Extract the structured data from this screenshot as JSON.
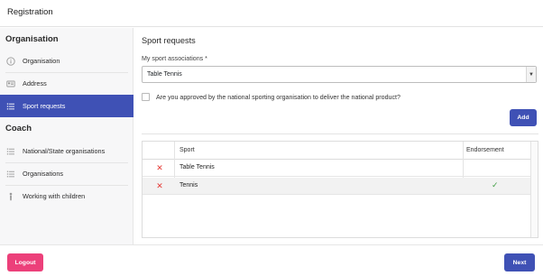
{
  "window": {
    "title": "Registration"
  },
  "sidebar": {
    "sections": [
      {
        "title": "Organisation",
        "items": [
          {
            "label": "Organisation",
            "icon": "info-icon",
            "active": false
          },
          {
            "label": "Address",
            "icon": "address-card-icon",
            "active": false
          },
          {
            "label": "Sport requests",
            "icon": "list-icon",
            "active": true
          }
        ]
      },
      {
        "title": "Coach",
        "items": [
          {
            "label": "National/State organisations",
            "icon": "list-icon",
            "active": false
          },
          {
            "label": "Organisations",
            "icon": "list-icon",
            "active": false
          },
          {
            "label": "Working with children",
            "icon": "child-icon",
            "active": false
          }
        ]
      }
    ]
  },
  "main": {
    "heading": "Sport requests",
    "associations_label": "My sport associations *",
    "associations_value": "Table Tennis",
    "approval_question": "Are you approved by the national sporting organisation to deliver the national product?",
    "approval_checked": false,
    "add_label": "Add",
    "table": {
      "columns": [
        "",
        "Sport",
        "Endorsement"
      ],
      "rows": [
        {
          "sport": "Table Tennis",
          "endorsed": false
        },
        {
          "sport": "Tennis",
          "endorsed": true
        }
      ]
    }
  },
  "footer": {
    "logout_label": "Logout",
    "next_label": "Next"
  },
  "colors": {
    "primary": "#3f51b5",
    "logout": "#ec407a",
    "delete": "#e53935",
    "check": "#43a047"
  }
}
